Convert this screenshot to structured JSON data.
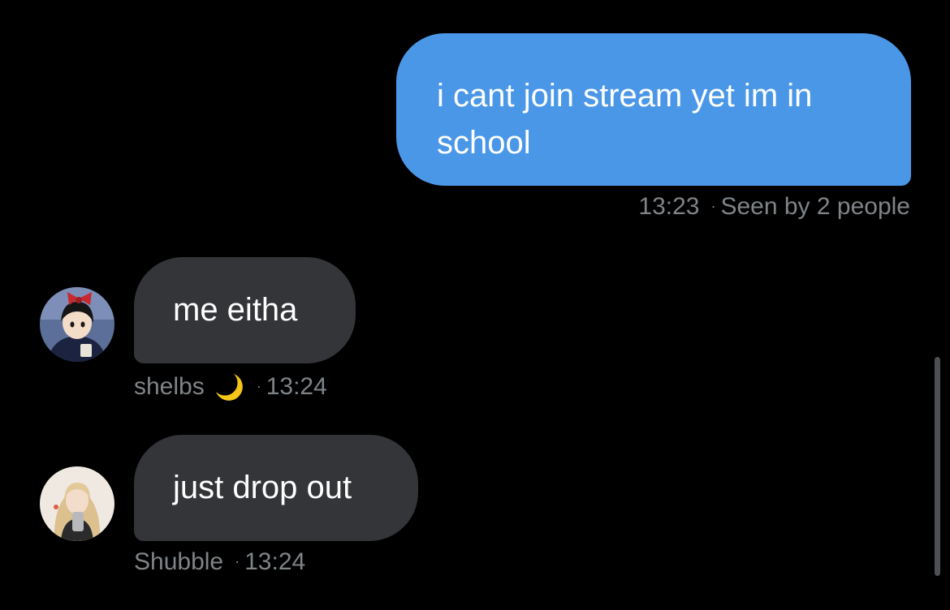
{
  "messages": {
    "outgoing": {
      "text": "i cant join stream yet im in school",
      "time": "13:23",
      "dot": "·",
      "status": "Seen by 2 people"
    },
    "incoming": [
      {
        "text": "me eitha",
        "sender": "shelbs",
        "sender_emoji_icon": "crescent-moon-icon",
        "dot": "·",
        "time": "13:24"
      },
      {
        "text": "just drop out",
        "sender": "Shubble",
        "dot": "·",
        "time": "13:24"
      }
    ]
  },
  "colors": {
    "background": "#000000",
    "outgoing_bubble": "#4a97e8",
    "incoming_bubble": "#333538",
    "meta_text": "#7f8488"
  }
}
